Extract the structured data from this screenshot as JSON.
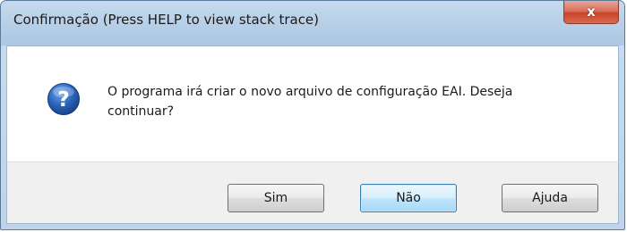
{
  "window": {
    "title": "Confirmação (Press HELP to view stack trace)",
    "close_label": "x"
  },
  "dialog": {
    "icon": "question-icon",
    "message": "O programa irá criar o novo arquivo de configuração EAI. Deseja continuar?"
  },
  "buttons": {
    "yes_label": "Sim",
    "no_label": "Não",
    "help_label": "Ajuda"
  },
  "colors": {
    "icon_blue": "#2a63b8",
    "close_red": "#c9452b",
    "default_button_border": "#3c7fb1"
  }
}
